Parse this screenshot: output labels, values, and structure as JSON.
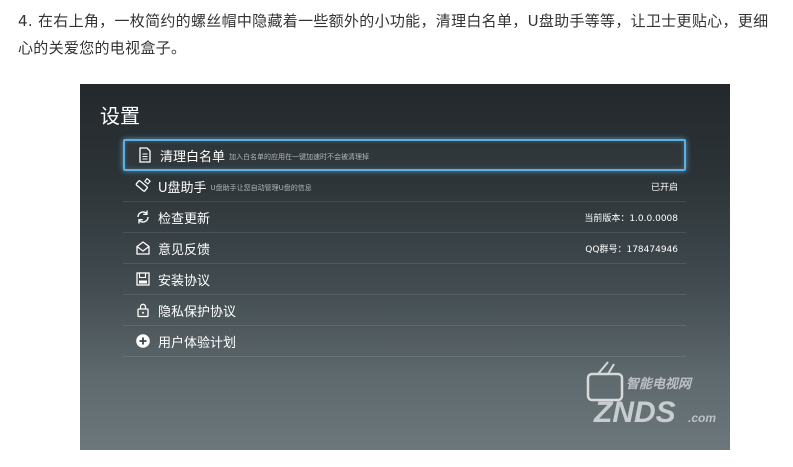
{
  "caption": "4. 在右上角，一枚简约的螺丝帽中隐藏着一些额外的小功能，清理白名单，U盘助手等等，让卫士更贴心，更细心的关爱您的电视盒子。",
  "screen": {
    "title": "设置",
    "items": [
      {
        "label": "清理白名单",
        "sub": "加入白名单的应用在一键加速时不会被清理掉",
        "value": "",
        "icon": "document-icon"
      },
      {
        "label": "U盘助手",
        "sub": "U盘助手让您自动管理U盘的信息",
        "value": "已开启",
        "icon": "usb-icon"
      },
      {
        "label": "检查更新",
        "sub": "",
        "value": "当前版本：1.0.0.0008",
        "icon": "refresh-icon"
      },
      {
        "label": "意见反馈",
        "sub": "",
        "value": "QQ群号：178474946",
        "icon": "mail-icon"
      },
      {
        "label": "安装协议",
        "sub": "",
        "value": "",
        "icon": "save-icon"
      },
      {
        "label": "隐私保护协议",
        "sub": "",
        "value": "",
        "icon": "lock-icon"
      },
      {
        "label": "用户体验计划",
        "sub": "",
        "value": "",
        "icon": "plus-circle-icon"
      }
    ]
  },
  "watermark": {
    "top": "智能电视网",
    "main": "ZNDS",
    "suffix": ".com"
  },
  "colors": {
    "focus": "#5fb0e0",
    "background_top": "#23282c",
    "background_bottom": "#6c777c"
  }
}
